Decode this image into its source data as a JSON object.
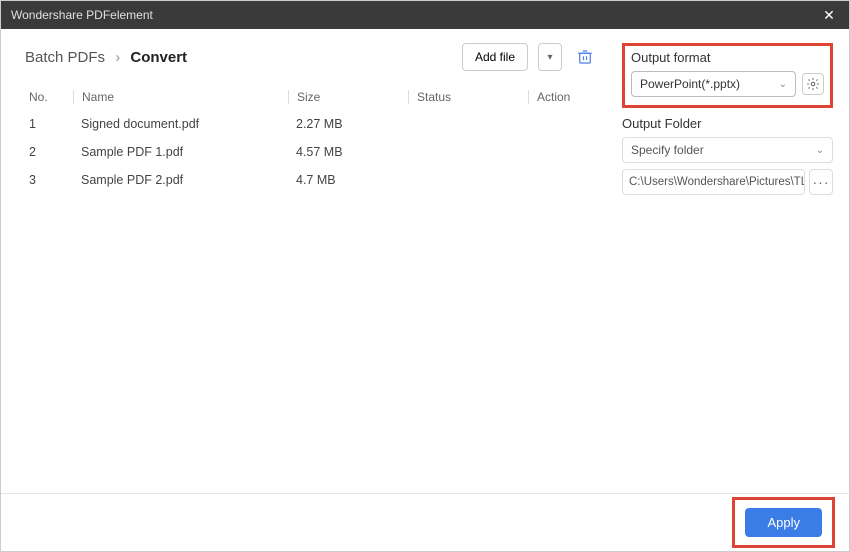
{
  "titlebar": {
    "title": "Wondershare PDFelement"
  },
  "breadcrumb": {
    "root": "Batch PDFs",
    "current": "Convert"
  },
  "toolbar": {
    "addFile": "Add file"
  },
  "table": {
    "headers": {
      "no": "No.",
      "name": "Name",
      "size": "Size",
      "status": "Status",
      "action": "Action"
    },
    "rows": [
      {
        "no": "1",
        "name": "Signed document.pdf",
        "size": "2.27 MB",
        "status": "",
        "action": ""
      },
      {
        "no": "2",
        "name": "Sample PDF 1.pdf",
        "size": "4.57 MB",
        "status": "",
        "action": ""
      },
      {
        "no": "3",
        "name": "Sample PDF 2.pdf",
        "size": "4.7 MB",
        "status": "",
        "action": ""
      }
    ]
  },
  "right": {
    "outputFormatLabel": "Output format",
    "outputFormatValue": "PowerPoint(*.pptx)",
    "outputFolderLabel": "Output Folder",
    "folderMode": "Specify folder",
    "folderPath": "C:\\Users\\Wondershare\\Pictures\\TLDR T"
  },
  "footer": {
    "apply": "Apply"
  }
}
